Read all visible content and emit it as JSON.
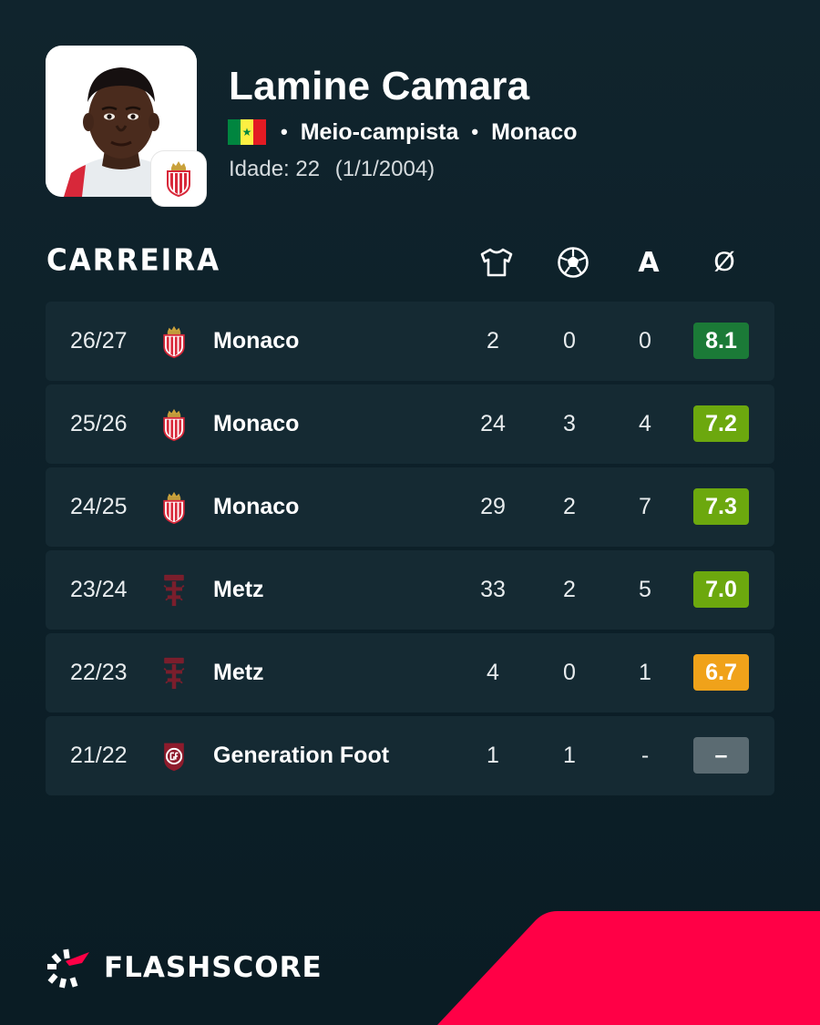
{
  "player": {
    "name": "Lamine Camara",
    "position": "Meio-campista",
    "club": "Monaco",
    "age_label": "Idade: 22",
    "birth_date": "(1/1/2004)",
    "flag_colors": [
      "#00853f",
      "#fdef42",
      "#e31b23"
    ]
  },
  "career": {
    "title": "CARREIRA",
    "columns": {
      "appearances_icon": "jersey-icon",
      "goals_icon": "ball-icon",
      "assists": "A",
      "average": "Ø"
    },
    "rows": [
      {
        "season": "26/27",
        "club": "Monaco",
        "logo": "monaco-logo",
        "apps": "2",
        "goals": "0",
        "assists": "0",
        "rating": "8.1",
        "rating_color": "#1b7a37"
      },
      {
        "season": "25/26",
        "club": "Monaco",
        "logo": "monaco-logo",
        "apps": "24",
        "goals": "3",
        "assists": "4",
        "rating": "7.2",
        "rating_color": "#6ca80e"
      },
      {
        "season": "24/25",
        "club": "Monaco",
        "logo": "monaco-logo",
        "apps": "29",
        "goals": "2",
        "assists": "7",
        "rating": "7.3",
        "rating_color": "#6ca80e"
      },
      {
        "season": "23/24",
        "club": "Metz",
        "logo": "metz-logo",
        "apps": "33",
        "goals": "2",
        "assists": "5",
        "rating": "7.0",
        "rating_color": "#6ca80e"
      },
      {
        "season": "22/23",
        "club": "Metz",
        "logo": "metz-logo",
        "apps": "4",
        "goals": "0",
        "assists": "1",
        "rating": "6.7",
        "rating_color": "#f0a21a"
      },
      {
        "season": "21/22",
        "club": "Generation Foot",
        "logo": "generation-foot-logo",
        "apps": "1",
        "goals": "1",
        "assists": "-",
        "rating": "–",
        "rating_color": "#5b6b72"
      }
    ]
  },
  "brand": {
    "name": "FLASHSCORE",
    "accent": "#ff0046"
  }
}
